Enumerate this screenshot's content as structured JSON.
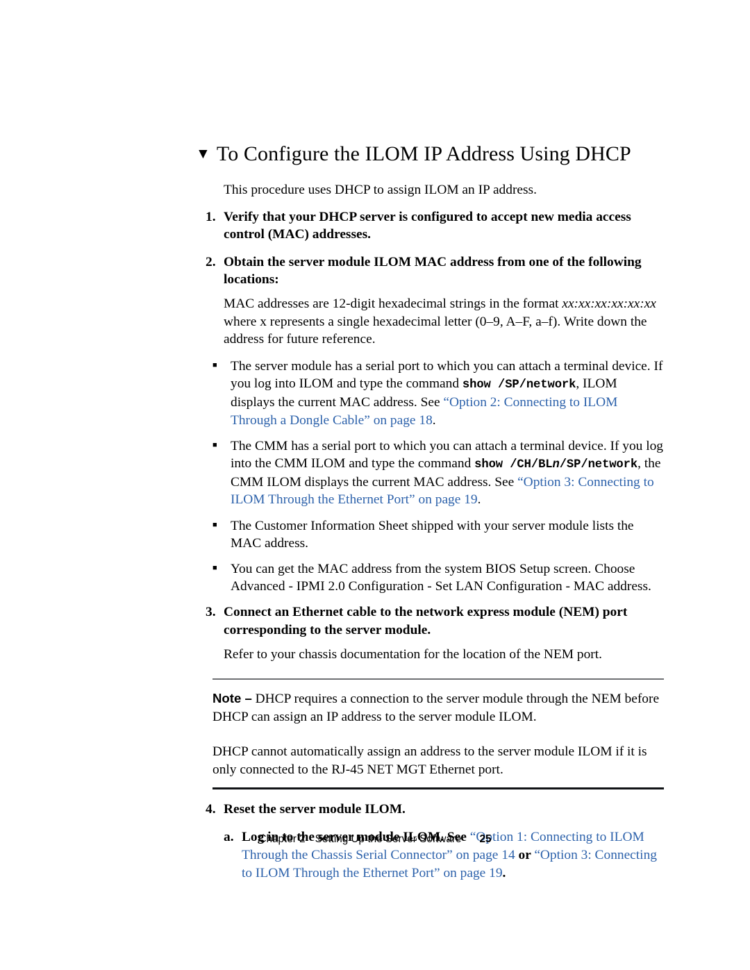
{
  "page": {
    "heading_marker": "▼",
    "heading": "To Configure the ILOM IP Address Using DHCP",
    "intro": "This procedure uses DHCP to assign ILOM an IP address.",
    "bullet_marker": "■"
  },
  "steps": {
    "step1_num": "1.",
    "step1_text": "Verify that your DHCP server is configured to accept new media access control (MAC) addresses.",
    "step2_num": "2.",
    "step2_text": "Obtain the server module ILOM MAC address from one of the following locations:",
    "step2_body_a": "MAC addresses are 12-digit hexadecimal strings in the format ",
    "step2_body_format": "xx:xx:xx:xx:xx:xx",
    "step2_body_b": " where x represents a single hexadecimal letter (0–9, A–F, a–f). Write down the address for future reference.",
    "step3_num": "3.",
    "step3_text": "Connect an Ethernet cable to the network express module (NEM) port corresponding to the server module.",
    "step3_body": "Refer to your chassis documentation for the location of the NEM port.",
    "step4_num": "4.",
    "step4_text": "Reset the server module ILOM.",
    "substep_a_num": "a.",
    "substep_a_lead": "Log in to the server module ILOM. See ",
    "substep_a_link1": "“Option 1: Connecting to ILOM Through the Chassis Serial Connector” on page 14",
    "substep_a_mid": " or ",
    "substep_a_link2": "“Option 3: Connecting to ILOM Through the Ethernet Port” on page 19",
    "substep_a_end": "."
  },
  "bullets": [
    {
      "pre": "The server module has a serial port to which you can attach a terminal device. If you log into ILOM and type the command ",
      "command": "show /SP/network",
      "command_italic": "",
      "command_post": "",
      "mid": ", ILOM displays the current MAC address. See ",
      "link": "“Option 2: Connecting to ILOM Through a Dongle Cable” on page 18",
      "post": "."
    },
    {
      "pre": "The CMM has a serial port to which you can attach a terminal device. If you log into the CMM ILOM and type the command ",
      "command": "show /CH/BL",
      "command_italic": "n",
      "command_post": "/SP/network",
      "mid": ", the CMM ILOM displays the current MAC address. See ",
      "link": "“Option 3: Connecting to ILOM Through the Ethernet Port” on page 19",
      "post": "."
    },
    {
      "pre": "The Customer Information Sheet shipped with your server module lists the MAC address.",
      "command": "",
      "command_italic": "",
      "command_post": "",
      "mid": "",
      "link": "",
      "post": ""
    },
    {
      "pre": "You can get the MAC address from the system BIOS Setup screen. Choose Advanced - IPMI 2.0 Configuration - Set LAN Configuration - MAC address.",
      "command": "",
      "command_italic": "",
      "command_post": "",
      "mid": "",
      "link": "",
      "post": ""
    }
  ],
  "note": {
    "label": "Note –",
    "paragraph1": " DHCP requires a connection to the server module through the NEM before DHCP can assign an IP address to the server module ILOM.",
    "paragraph2": "DHCP cannot automatically assign an address to the server module ILOM if it is only connected to the RJ-45 NET MGT Ethernet port."
  },
  "footer": {
    "chapter": "Chapter 2",
    "title": "Setting Up the Server Software",
    "page_number": "25"
  },
  "colors": {
    "link": "#2d62ab",
    "rule_top": "#6e7073",
    "rule_bottom": "#111316"
  }
}
